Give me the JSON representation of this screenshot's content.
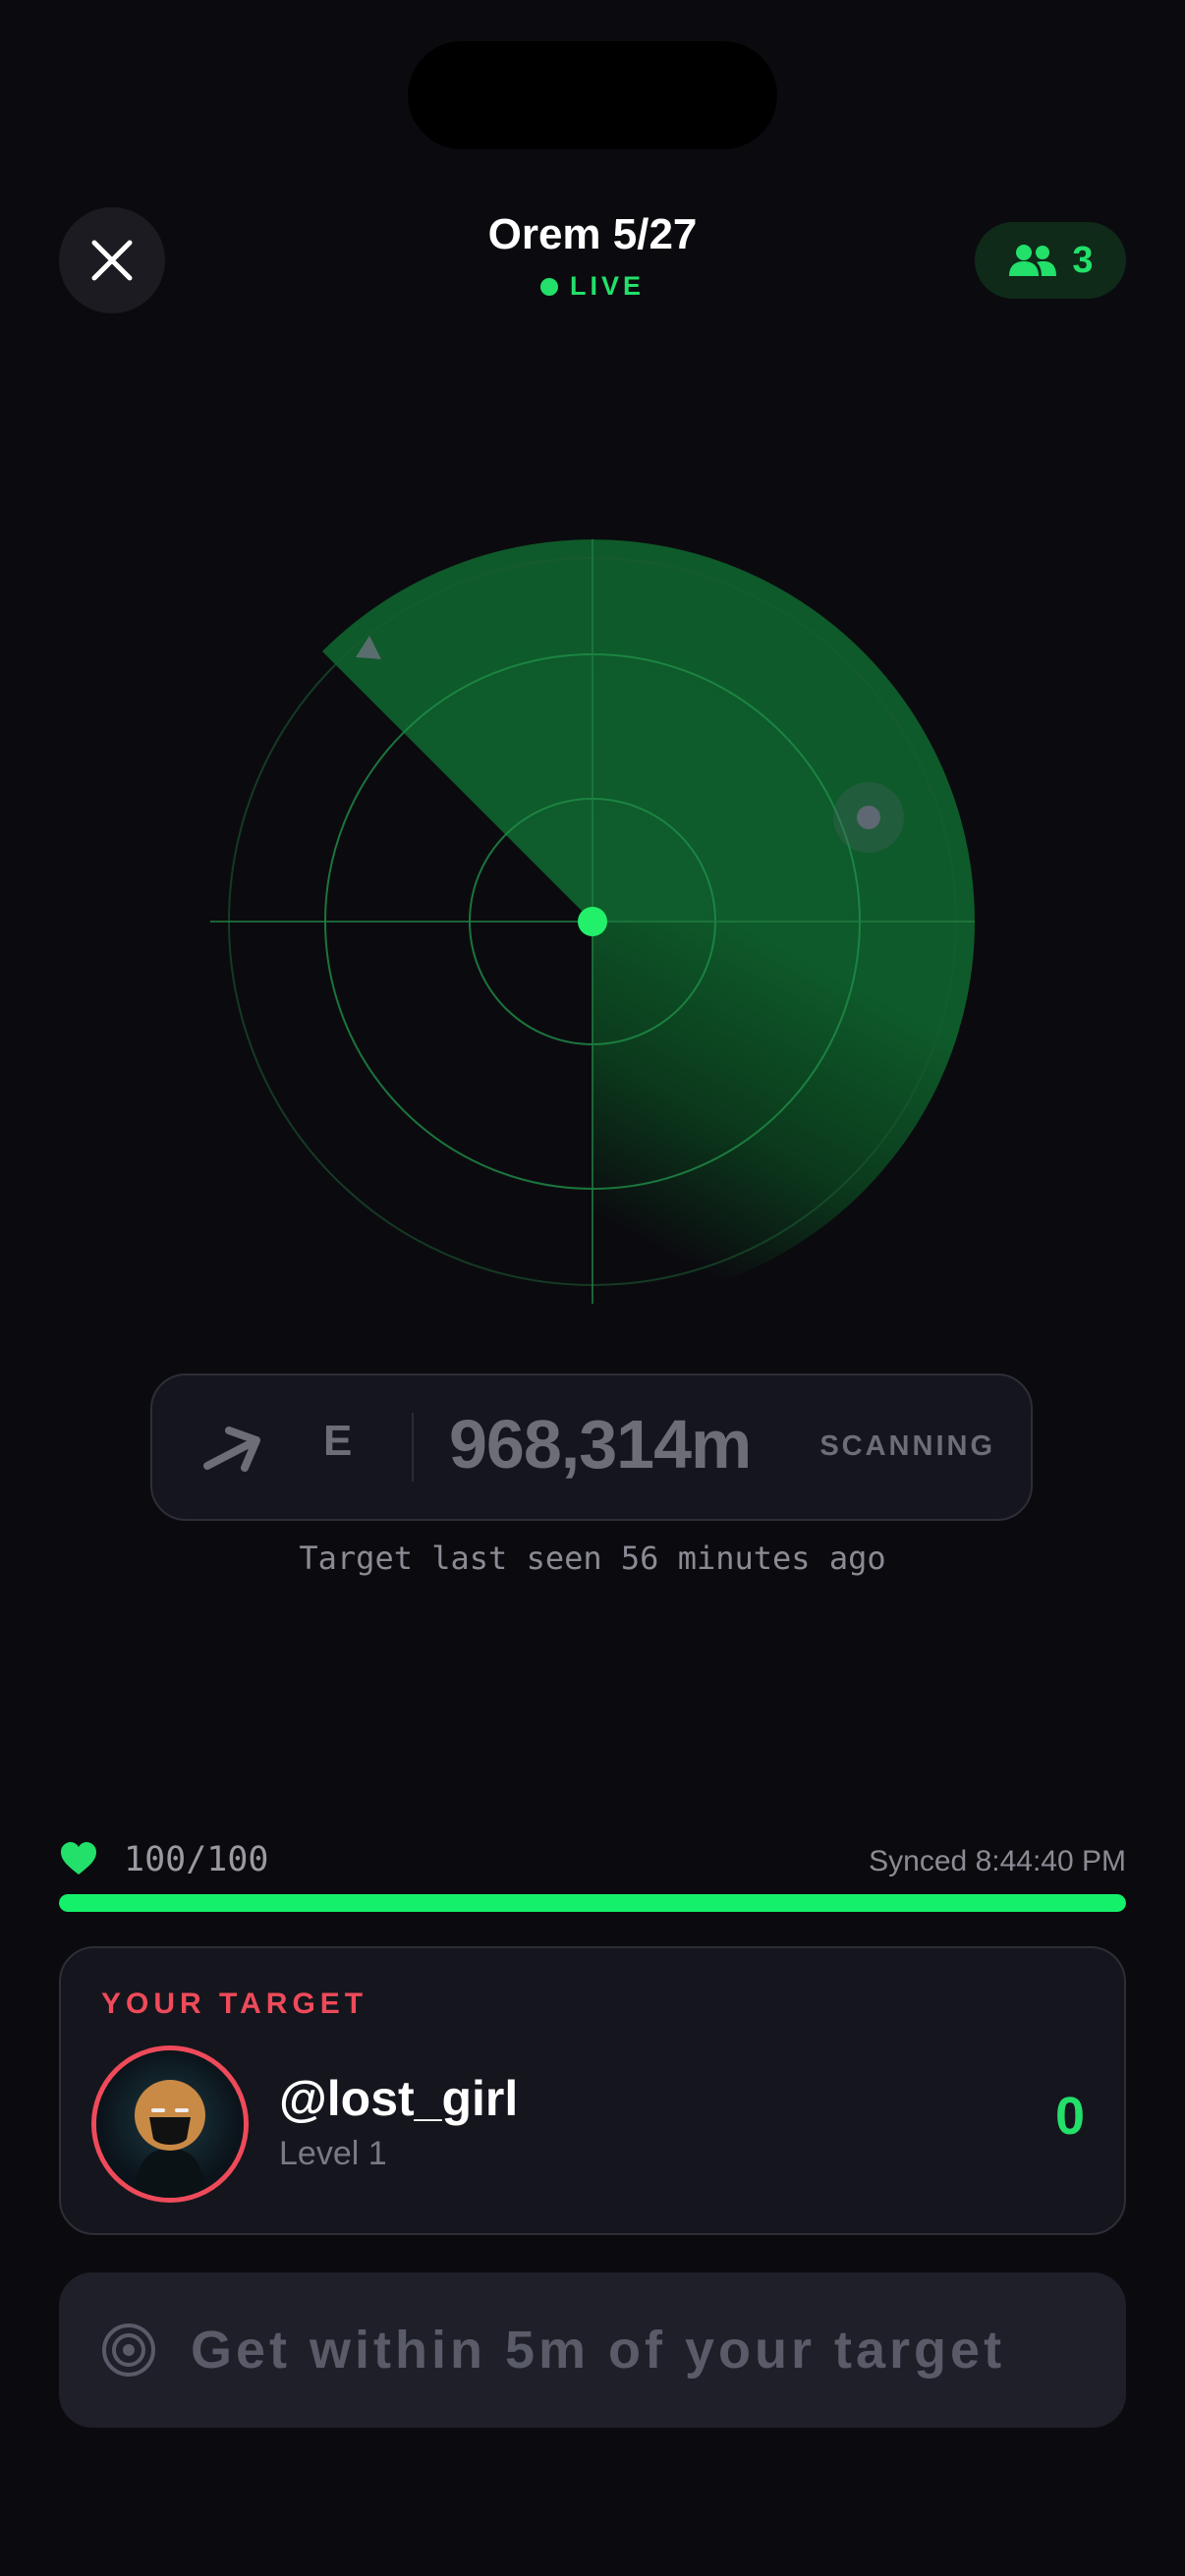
{
  "header": {
    "title": "Orem 5/27",
    "live_label": "LIVE",
    "players_count": "3",
    "close_icon": "close-icon",
    "players_icon": "users-icon"
  },
  "radar": {
    "center_dot_color": "#22e06a",
    "sweep_color": "#0e5a2a",
    "blips": [
      "target-blip",
      "player-blip"
    ]
  },
  "navigation": {
    "direction_icon": "arrow-icon",
    "direction": "E",
    "distance": "968,314m",
    "status": "SCANNING"
  },
  "last_seen": "Target last seen 56 minutes ago",
  "health": {
    "icon": "heart-icon",
    "text": "100/100",
    "level_fraction": 1.0,
    "synced": "Synced 8:44:40 PM",
    "color": "#14f06a"
  },
  "target": {
    "label": "YOUR TARGET",
    "username": "@lost_girl",
    "level": "Level 1",
    "score": "0",
    "accent": "#ef4a5a"
  },
  "action": {
    "icon": "target-icon",
    "label": "Get within 5m of your target"
  }
}
